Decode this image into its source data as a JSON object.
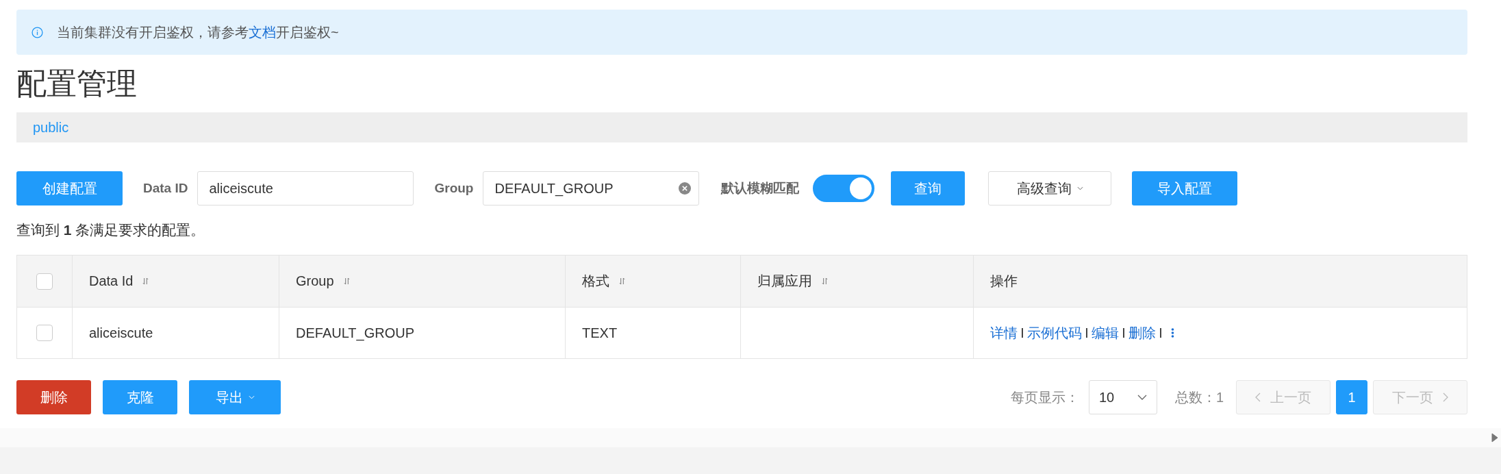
{
  "alert": {
    "before": "当前集群没有开启鉴权，请参考",
    "link": "文档",
    "after": "开启鉴权~"
  },
  "page_title": "配置管理",
  "namespace_tabs": [
    {
      "label": "public",
      "selected": true
    }
  ],
  "toolbar": {
    "create_button": "创建配置",
    "data_id_label": "Data ID",
    "data_id_value": "aliceiscute",
    "group_label": "Group",
    "group_value": "DEFAULT_GROUP",
    "fuzzy_label": "默认模糊匹配",
    "fuzzy_on": true,
    "query_button": "查询",
    "advanced_button": "高级查询",
    "import_button": "导入配置"
  },
  "result_summary": {
    "before": "查询到",
    "count": "1",
    "after": "条满足要求的配置。"
  },
  "table": {
    "header_checked": false,
    "columns": [
      {
        "label": "Data Id",
        "sortable": true
      },
      {
        "label": "Group",
        "sortable": true
      },
      {
        "label": "格式",
        "sortable": true
      },
      {
        "label": "归属应用",
        "sortable": true
      },
      {
        "label": "操作",
        "sortable": false
      }
    ],
    "rows": [
      {
        "checked": false,
        "cells": [
          "aliceiscute",
          "DEFAULT_GROUP",
          "TEXT",
          ""
        ],
        "actions": [
          "详情",
          "示例代码",
          "编辑",
          "删除"
        ]
      }
    ]
  },
  "bottom_buttons": [
    {
      "label": "删除",
      "kind": "danger"
    },
    {
      "label": "克隆",
      "kind": "primary"
    },
    {
      "label": "导出",
      "kind": "dropdown"
    }
  ],
  "pagination": {
    "page_size_label": "每页显示：",
    "page_size": "10",
    "total_label": "总数：1",
    "prev": "上一页",
    "next": "下一页",
    "pages": [
      {
        "label": "1",
        "selected": true
      }
    ]
  }
}
